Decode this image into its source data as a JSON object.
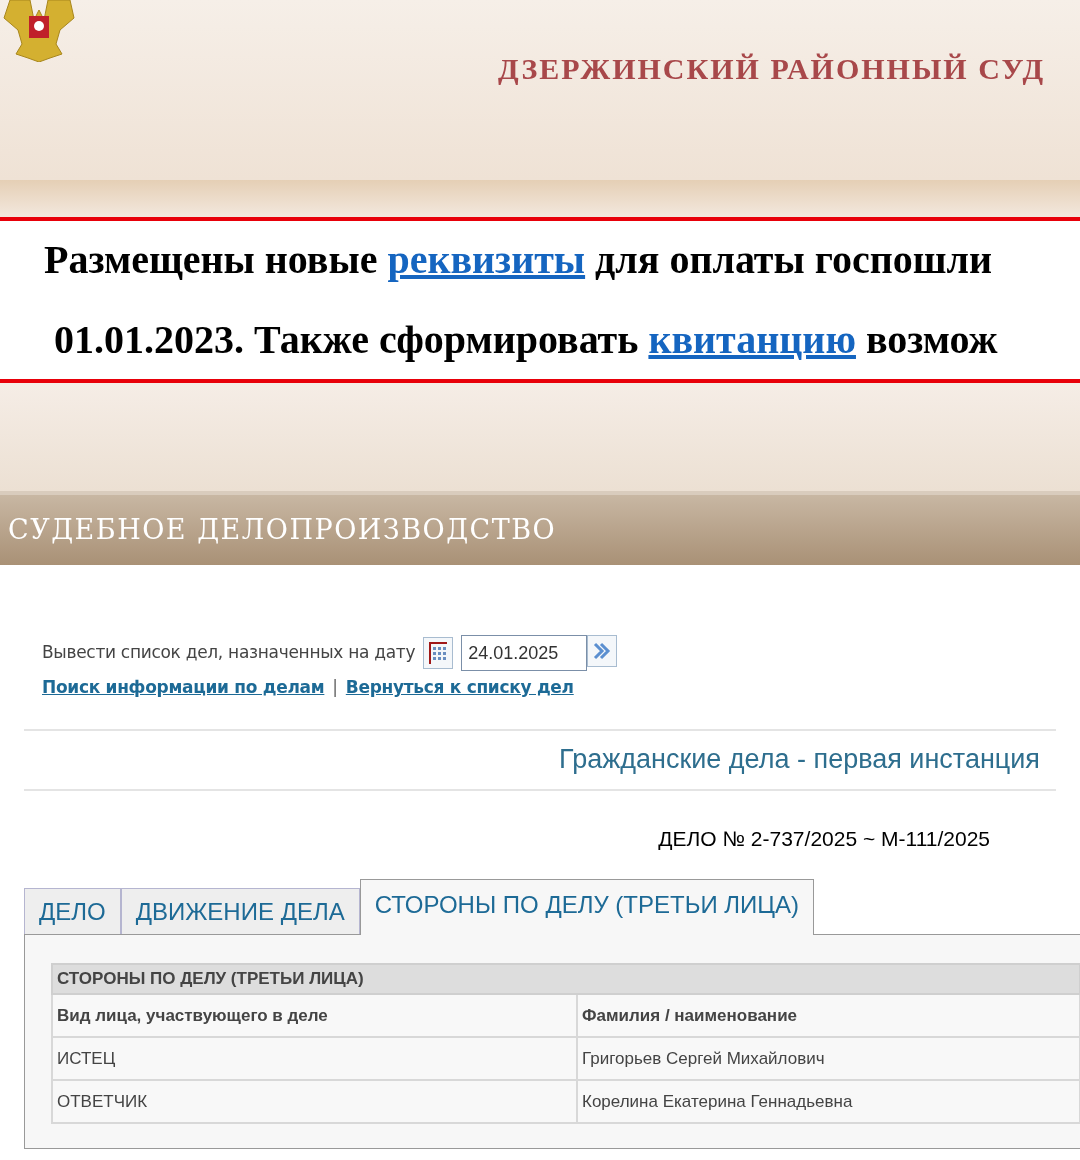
{
  "header": {
    "title": "ДЗЕРЖИНСКИЙ РАЙОННЫЙ СУД"
  },
  "notice": {
    "lines": [
      [
        {
          "kind": "text",
          "text": "Размещены новые "
        },
        {
          "kind": "link",
          "text": "реквизиты"
        },
        {
          "kind": "text",
          "text": " для оплаты госпошли"
        }
      ],
      [
        {
          "kind": "text",
          "text": "01.01.2023. Также сформировать "
        },
        {
          "kind": "link",
          "text": "квитанцию"
        },
        {
          "kind": "text",
          "text": " возмож"
        }
      ]
    ]
  },
  "section": {
    "title": "СУДЕБНОЕ ДЕЛОПРОИЗВОДСТВО"
  },
  "date_filter": {
    "label": "Вывести список дел, назначенных на дату",
    "value": "24.01.2025"
  },
  "links": [
    "Поиск информации по делам",
    "Вернуться к списку дел"
  ],
  "separator": "|",
  "category": "Гражданские дела - первая инстанция",
  "case_number": "ДЕЛО № 2-737/2025 ~ М-111/2025",
  "tabs": [
    {
      "label": "ДЕЛО",
      "selected": false
    },
    {
      "label": "ДВИЖЕНИЕ ДЕЛА",
      "selected": false
    },
    {
      "label": "СТОРОНЫ ПО ДЕЛУ (ТРЕТЬИ ЛИЦА)",
      "selected": true
    }
  ],
  "table": {
    "title": "СТОРОНЫ ПО ДЕЛУ (ТРЕТЬИ ЛИЦА)",
    "columns": [
      "Вид лица, участвующего в деле",
      "Фамилия / наименование"
    ],
    "rows": [
      [
        "ИСТЕЦ",
        "Григорьев Сергей Михайлович"
      ],
      [
        "ОТВЕТЧИК",
        "Корелина Екатерина Геннадьевна"
      ]
    ]
  }
}
